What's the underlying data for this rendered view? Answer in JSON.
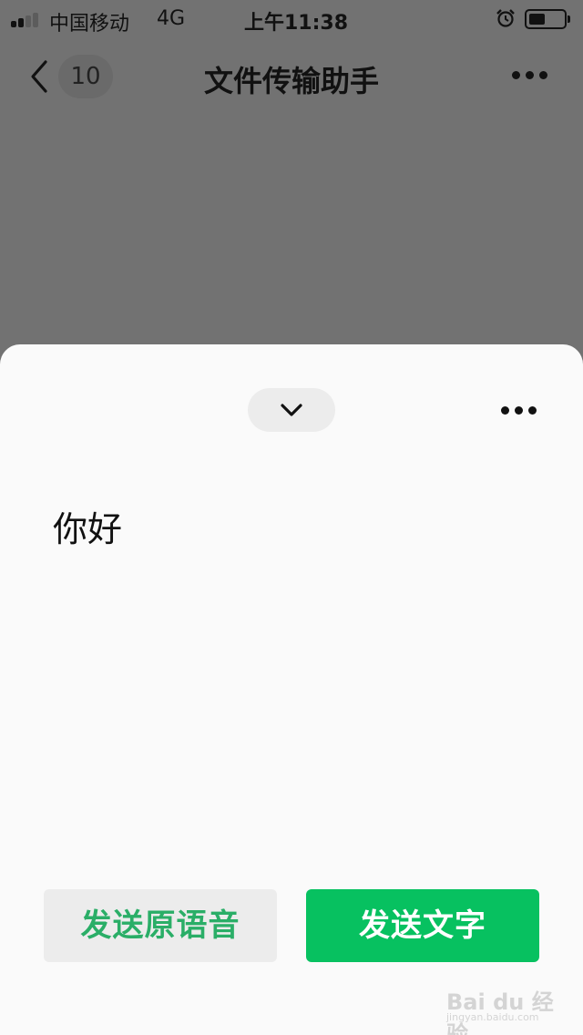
{
  "status_bar": {
    "carrier": "中国移动",
    "network": "4G",
    "time": "上午11:38",
    "alarm_icon": "alarm-clock-icon",
    "battery_icon": "battery-icon"
  },
  "nav": {
    "back_icon": "chevron-left-icon",
    "unread_count": "10",
    "title": "文件传输助手",
    "more_icon": "more-dots-icon"
  },
  "sheet": {
    "collapse_icon": "chevron-down-icon",
    "more_icon": "more-dots-icon",
    "transcript_text": "你好",
    "send_voice_label": "发送原语音",
    "send_text_label": "发送文字"
  },
  "watermark": {
    "brand": "Bai du 经验",
    "url": "jingyan.baidu.com"
  },
  "colors": {
    "overlay": "#727272",
    "sheet_bg": "#fafafa",
    "accent_green": "#07c160",
    "secondary_button_bg": "#ececec",
    "secondary_button_text": "#2aae67"
  }
}
